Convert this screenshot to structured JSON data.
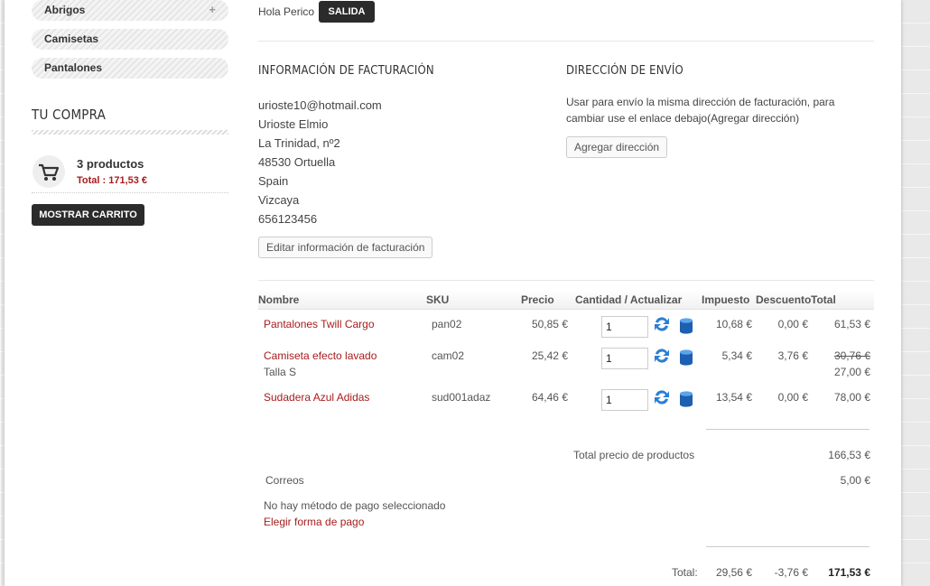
{
  "sidebar": {
    "categories": [
      {
        "label": "Abrigos",
        "expand": "+"
      },
      {
        "label": "Camisetas"
      },
      {
        "label": "Pantalones"
      }
    ],
    "cart_title": "TU COMPRA",
    "cart_count": "3 productos",
    "cart_total": "Total : 171,53 €",
    "show_cart_label": "MOSTRAR CARRITO"
  },
  "header": {
    "greeting": "Hola Perico",
    "logout_label": "SALIDA"
  },
  "billing": {
    "title": "INFORMACIÓN DE FACTURACIÓN",
    "lines": [
      "urioste10@hotmail.com",
      "Urioste Elmio",
      "La Trinidad, nº2",
      "48530 Ortuella",
      "Spain",
      "Vizcaya",
      "656123456"
    ],
    "edit_label": "Editar información de facturación"
  },
  "shipping": {
    "title": "DIRECCIÓN DE ENVÍO",
    "text": "Usar para envío la misma dirección de facturación, para cambiar use el enlace debajo(Agregar dirección)",
    "add_label": "Agregar dirección"
  },
  "table": {
    "headers": {
      "name": "Nombre",
      "sku": "SKU",
      "price": "Precio",
      "qty": "Cantidad / Actualizar",
      "tax": "Impuesto",
      "discount": "Descuento",
      "total": "Total"
    },
    "rows": [
      {
        "name": "Pantalones Twill Cargo",
        "variant": "",
        "sku": "pan02",
        "price": "50,85 €",
        "qty": "1",
        "tax": "10,68 €",
        "discount": "0,00 €",
        "total": "61,53 €",
        "old_total": ""
      },
      {
        "name": "Camiseta efecto lavado",
        "variant": "Talla S",
        "sku": "cam02",
        "price": "25,42 €",
        "qty": "1",
        "tax": "5,34 €",
        "discount": "3,76 €",
        "total": "27,00 €",
        "old_total": "30,76 €"
      },
      {
        "name": "Sudadera Azul Adidas",
        "variant": "",
        "sku": "sud001adaz",
        "price": "64,46 €",
        "qty": "1",
        "tax": "13,54 €",
        "discount": "0,00 €",
        "total": "78,00 €",
        "old_total": ""
      }
    ]
  },
  "summary": {
    "products_label": "Total precio de productos",
    "products_total": "166,53 €",
    "shipping_method": "Correos",
    "shipping_cost": "5,00 €",
    "payment_note": "No hay método de pago seleccionado",
    "payment_link": "Elegir forma de pago",
    "total_label": "Total:",
    "total_tax": "29,56 €",
    "total_discount": "-3,76 €",
    "grand_total": "171,53 €"
  },
  "colors": {
    "accent_red": "#a81c1c",
    "dark_button": "#2b2b2b",
    "icon_blue": "#2a7fd4"
  },
  "icons": {
    "cart": "shopping-cart-icon",
    "refresh": "refresh-icon",
    "delete": "trash-icon"
  }
}
